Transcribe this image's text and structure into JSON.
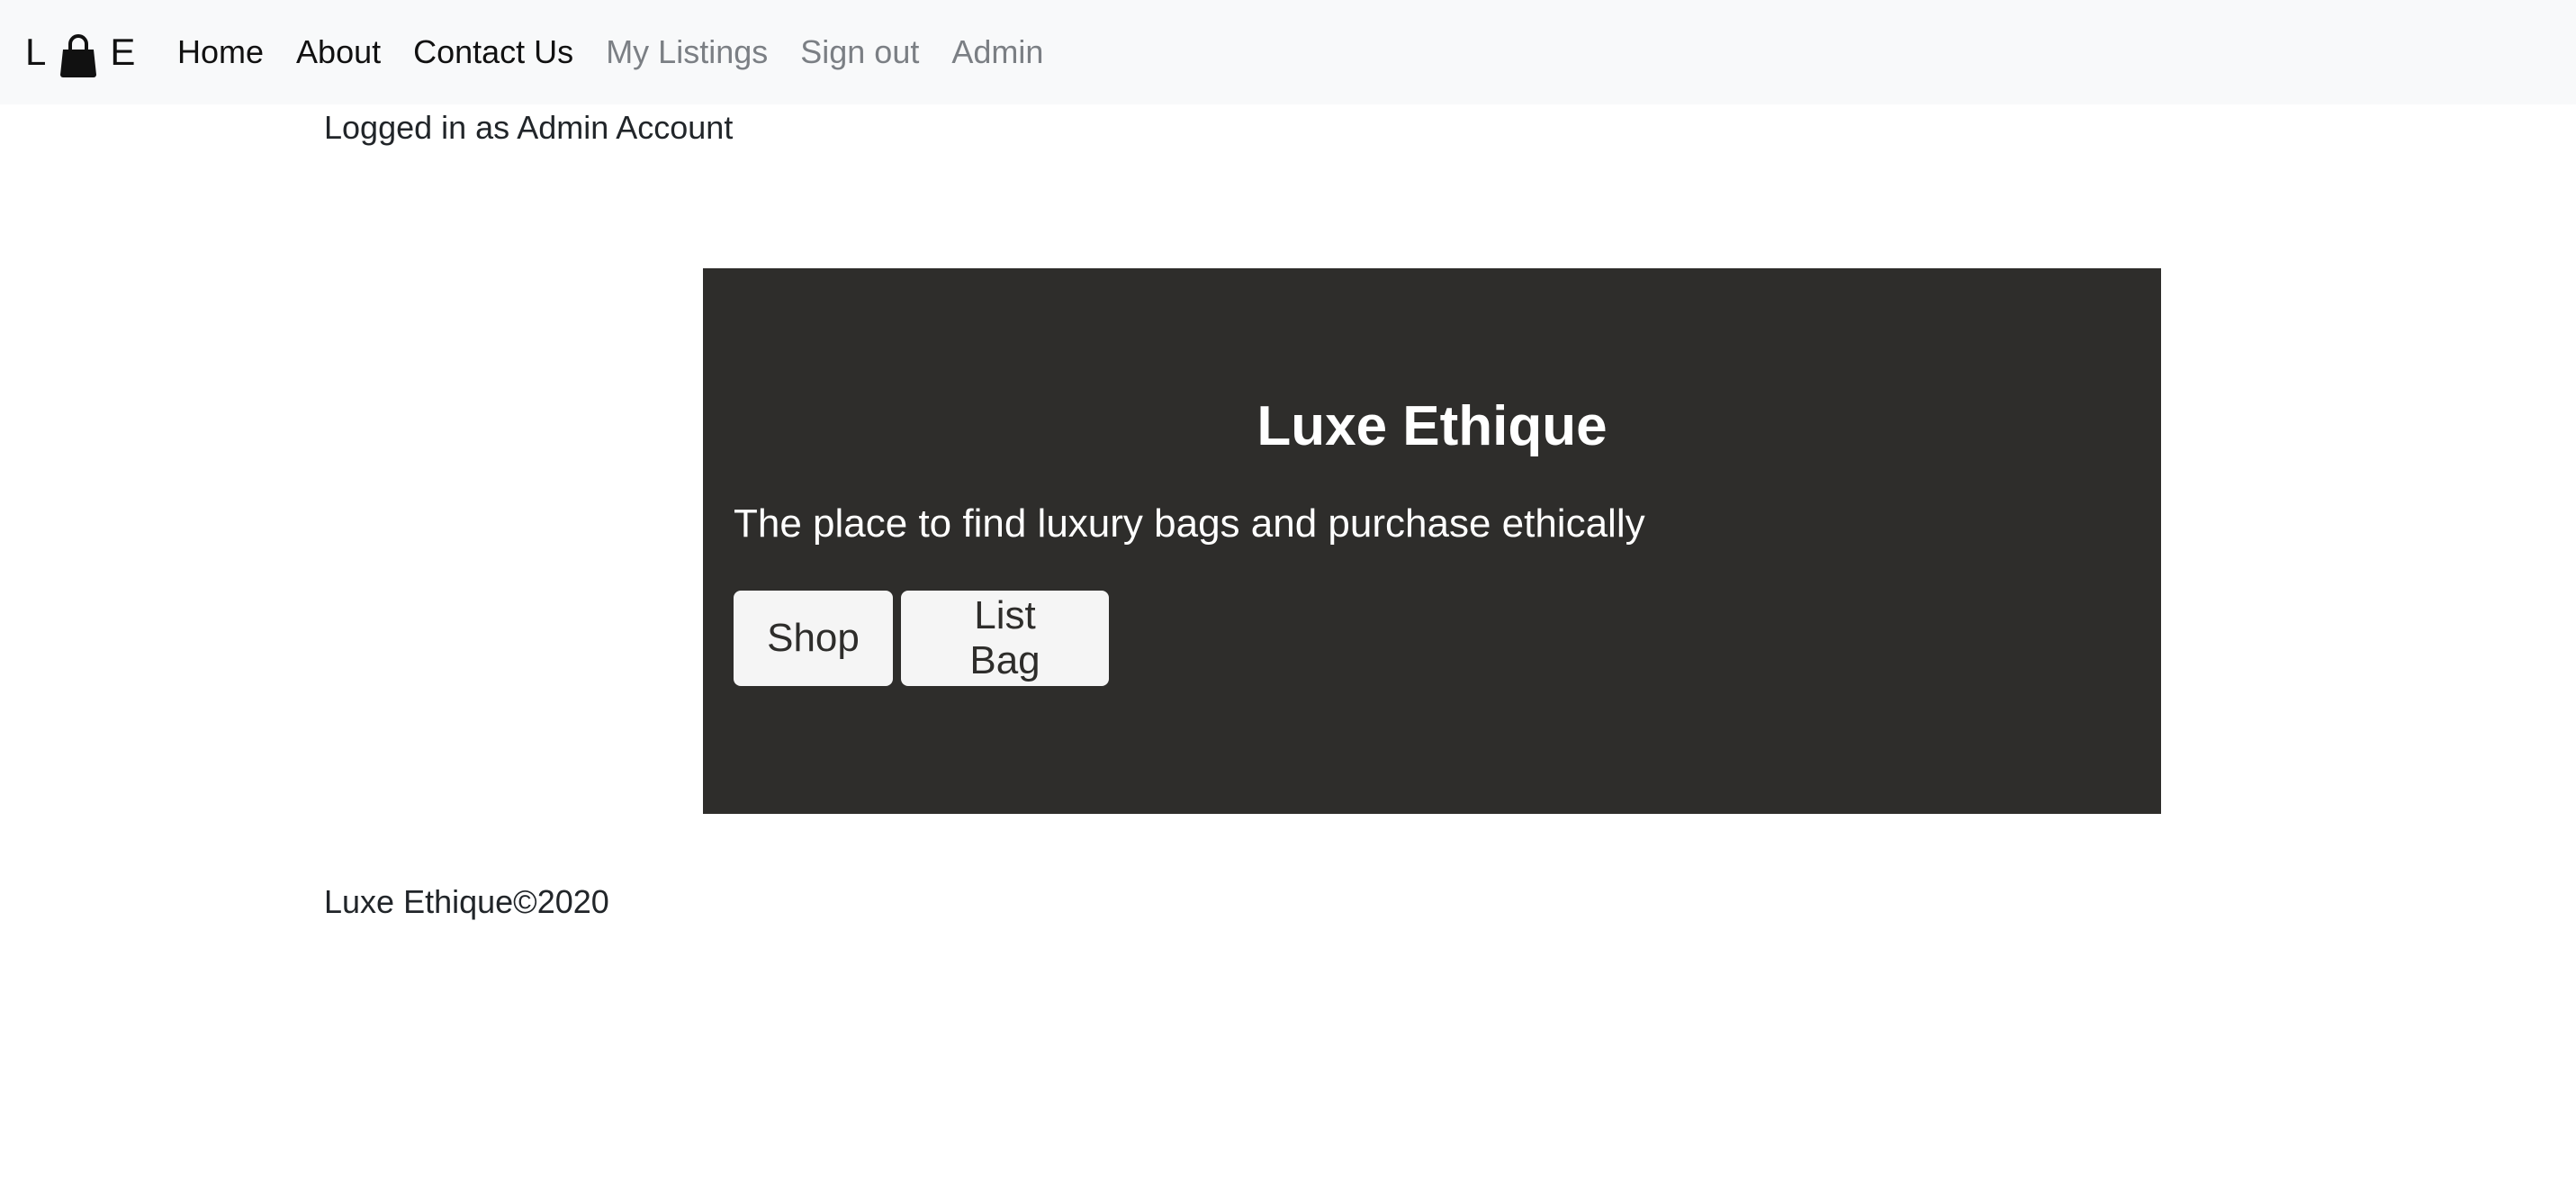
{
  "navbar": {
    "brand_left": "L",
    "brand_icon": "shopping-bag-icon",
    "brand_right": "E",
    "links": [
      {
        "label": "Home",
        "state": "active"
      },
      {
        "label": "About",
        "state": "active"
      },
      {
        "label": "Contact Us",
        "state": "active"
      },
      {
        "label": "My Listings",
        "state": "muted"
      },
      {
        "label": "Sign out",
        "state": "muted"
      },
      {
        "label": "Admin",
        "state": "muted"
      }
    ]
  },
  "status": {
    "logged_in_text": "Logged in as Admin Account"
  },
  "hero": {
    "title": "Luxe Ethique",
    "subtitle": "The place to find luxury bags and purchase ethically",
    "shop_label": "Shop",
    "list_bag_label": "List Bag",
    "background_color": "#2e2d2b",
    "button_color": "#f5f5f5"
  },
  "footer": {
    "text": "Luxe Ethique©2020"
  },
  "colors": {
    "navbar_bg": "#f8f9fa",
    "muted_link": "#7b7f84"
  }
}
